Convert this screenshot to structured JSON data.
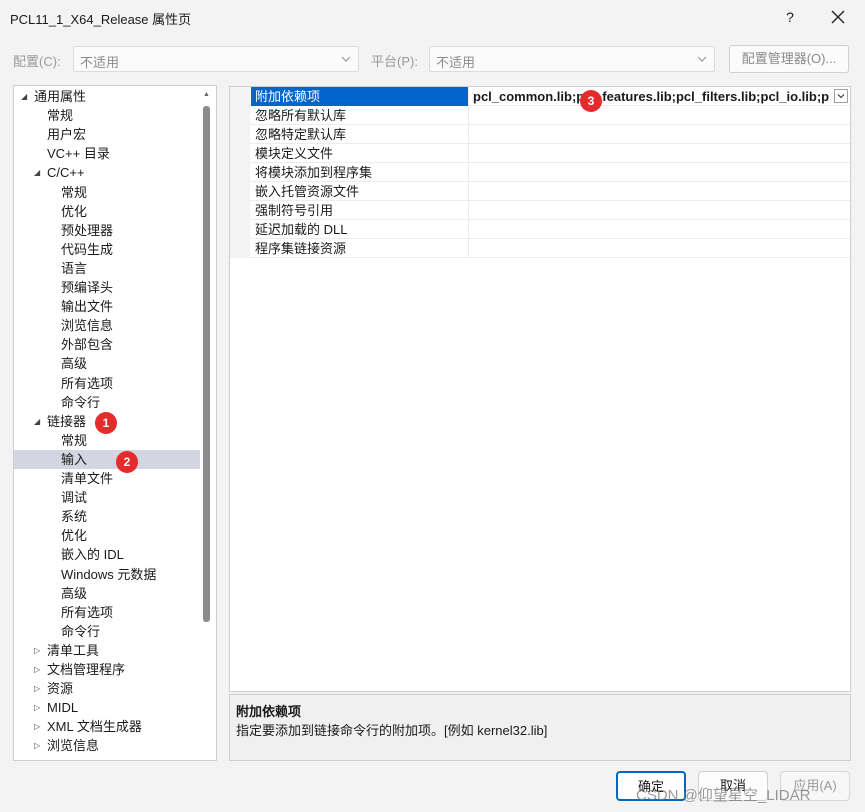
{
  "window": {
    "title": "PCL11_1_X64_Release 属性页",
    "help_label": "?"
  },
  "config_bar": {
    "config_label": "配置(C):",
    "config_value": "不适用",
    "platform_label": "平台(P):",
    "platform_value": "不适用",
    "manager_button": "配置管理器(O)..."
  },
  "tree": {
    "items": [
      {
        "label": "通用属性",
        "level": 0,
        "expander": "expanded"
      },
      {
        "label": "常规",
        "level": 1,
        "expander": "none"
      },
      {
        "label": "用户宏",
        "level": 1,
        "expander": "none"
      },
      {
        "label": "VC++ 目录",
        "level": 1,
        "expander": "none"
      },
      {
        "label": "C/C++",
        "level": 1,
        "expander": "expanded"
      },
      {
        "label": "常规",
        "level": 2,
        "expander": "none"
      },
      {
        "label": "优化",
        "level": 2,
        "expander": "none"
      },
      {
        "label": "预处理器",
        "level": 2,
        "expander": "none"
      },
      {
        "label": "代码生成",
        "level": 2,
        "expander": "none"
      },
      {
        "label": "语言",
        "level": 2,
        "expander": "none"
      },
      {
        "label": "预编译头",
        "level": 2,
        "expander": "none"
      },
      {
        "label": "输出文件",
        "level": 2,
        "expander": "none"
      },
      {
        "label": "浏览信息",
        "level": 2,
        "expander": "none"
      },
      {
        "label": "外部包含",
        "level": 2,
        "expander": "none"
      },
      {
        "label": "高级",
        "level": 2,
        "expander": "none"
      },
      {
        "label": "所有选项",
        "level": 2,
        "expander": "none"
      },
      {
        "label": "命令行",
        "level": 2,
        "expander": "none"
      },
      {
        "label": "链接器",
        "level": 1,
        "expander": "expanded"
      },
      {
        "label": "常规",
        "level": 2,
        "expander": "none"
      },
      {
        "label": "输入",
        "level": 2,
        "expander": "none",
        "selected": true
      },
      {
        "label": "清单文件",
        "level": 2,
        "expander": "none"
      },
      {
        "label": "调试",
        "level": 2,
        "expander": "none"
      },
      {
        "label": "系统",
        "level": 2,
        "expander": "none"
      },
      {
        "label": "优化",
        "level": 2,
        "expander": "none"
      },
      {
        "label": "嵌入的 IDL",
        "level": 2,
        "expander": "none"
      },
      {
        "label": "Windows 元数据",
        "level": 2,
        "expander": "none"
      },
      {
        "label": "高级",
        "level": 2,
        "expander": "none"
      },
      {
        "label": "所有选项",
        "level": 2,
        "expander": "none"
      },
      {
        "label": "命令行",
        "level": 2,
        "expander": "none"
      },
      {
        "label": "清单工具",
        "level": 1,
        "expander": "collapsed"
      },
      {
        "label": "文档管理程序",
        "level": 1,
        "expander": "collapsed"
      },
      {
        "label": "资源",
        "level": 1,
        "expander": "collapsed"
      },
      {
        "label": "MIDL",
        "level": 1,
        "expander": "collapsed"
      },
      {
        "label": "XML 文档生成器",
        "level": 1,
        "expander": "collapsed"
      },
      {
        "label": "浏览信息",
        "level": 1,
        "expander": "collapsed"
      }
    ]
  },
  "grid": {
    "rows": [
      {
        "name": "附加依赖项",
        "value": "pcl_common.lib;pcl_features.lib;pcl_filters.lib;pcl_io.lib;p",
        "selected": true
      },
      {
        "name": "忽略所有默认库",
        "value": ""
      },
      {
        "name": "忽略特定默认库",
        "value": ""
      },
      {
        "name": "模块定义文件",
        "value": ""
      },
      {
        "name": "将模块添加到程序集",
        "value": ""
      },
      {
        "name": "嵌入托管资源文件",
        "value": ""
      },
      {
        "name": "强制符号引用",
        "value": ""
      },
      {
        "name": "延迟加载的 DLL",
        "value": ""
      },
      {
        "name": "程序集链接资源",
        "value": ""
      }
    ]
  },
  "description": {
    "title": "附加依赖项",
    "text": "指定要添加到链接命令行的附加项。[例如 kernel32.lib]"
  },
  "buttons": {
    "ok": "确定",
    "cancel": "取消",
    "apply": "应用(A)"
  },
  "annotations": [
    "1",
    "2",
    "3"
  ],
  "watermark": "CSDN @仰望星空_LIDAR",
  "colors": {
    "selection_blue": "#0066cc",
    "tree_selection": "#d3d6e0",
    "badge_red": "#e52b2b"
  }
}
